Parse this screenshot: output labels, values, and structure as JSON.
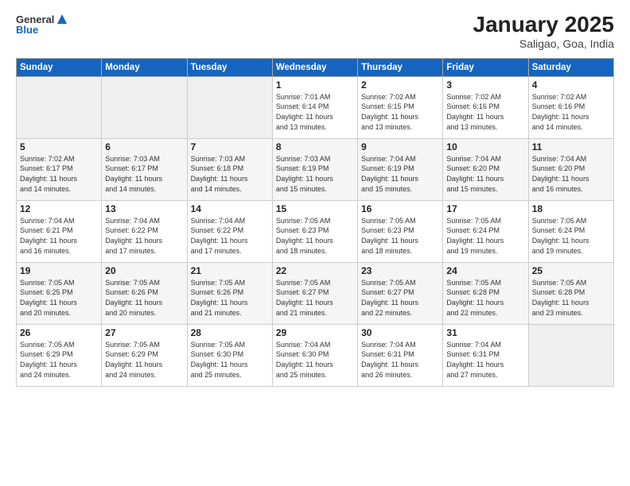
{
  "header": {
    "logo_line1": "General",
    "logo_line2": "Blue",
    "title": "January 2025",
    "subtitle": "Saligao, Goa, India"
  },
  "weekdays": [
    "Sunday",
    "Monday",
    "Tuesday",
    "Wednesday",
    "Thursday",
    "Friday",
    "Saturday"
  ],
  "weeks": [
    [
      {
        "day": "",
        "info": ""
      },
      {
        "day": "",
        "info": ""
      },
      {
        "day": "",
        "info": ""
      },
      {
        "day": "1",
        "info": "Sunrise: 7:01 AM\nSunset: 6:14 PM\nDaylight: 11 hours\nand 13 minutes."
      },
      {
        "day": "2",
        "info": "Sunrise: 7:02 AM\nSunset: 6:15 PM\nDaylight: 11 hours\nand 13 minutes."
      },
      {
        "day": "3",
        "info": "Sunrise: 7:02 AM\nSunset: 6:16 PM\nDaylight: 11 hours\nand 13 minutes."
      },
      {
        "day": "4",
        "info": "Sunrise: 7:02 AM\nSunset: 6:16 PM\nDaylight: 11 hours\nand 14 minutes."
      }
    ],
    [
      {
        "day": "5",
        "info": "Sunrise: 7:02 AM\nSunset: 6:17 PM\nDaylight: 11 hours\nand 14 minutes."
      },
      {
        "day": "6",
        "info": "Sunrise: 7:03 AM\nSunset: 6:17 PM\nDaylight: 11 hours\nand 14 minutes."
      },
      {
        "day": "7",
        "info": "Sunrise: 7:03 AM\nSunset: 6:18 PM\nDaylight: 11 hours\nand 14 minutes."
      },
      {
        "day": "8",
        "info": "Sunrise: 7:03 AM\nSunset: 6:19 PM\nDaylight: 11 hours\nand 15 minutes."
      },
      {
        "day": "9",
        "info": "Sunrise: 7:04 AM\nSunset: 6:19 PM\nDaylight: 11 hours\nand 15 minutes."
      },
      {
        "day": "10",
        "info": "Sunrise: 7:04 AM\nSunset: 6:20 PM\nDaylight: 11 hours\nand 15 minutes."
      },
      {
        "day": "11",
        "info": "Sunrise: 7:04 AM\nSunset: 6:20 PM\nDaylight: 11 hours\nand 16 minutes."
      }
    ],
    [
      {
        "day": "12",
        "info": "Sunrise: 7:04 AM\nSunset: 6:21 PM\nDaylight: 11 hours\nand 16 minutes."
      },
      {
        "day": "13",
        "info": "Sunrise: 7:04 AM\nSunset: 6:22 PM\nDaylight: 11 hours\nand 17 minutes."
      },
      {
        "day": "14",
        "info": "Sunrise: 7:04 AM\nSunset: 6:22 PM\nDaylight: 11 hours\nand 17 minutes."
      },
      {
        "day": "15",
        "info": "Sunrise: 7:05 AM\nSunset: 6:23 PM\nDaylight: 11 hours\nand 18 minutes."
      },
      {
        "day": "16",
        "info": "Sunrise: 7:05 AM\nSunset: 6:23 PM\nDaylight: 11 hours\nand 18 minutes."
      },
      {
        "day": "17",
        "info": "Sunrise: 7:05 AM\nSunset: 6:24 PM\nDaylight: 11 hours\nand 19 minutes."
      },
      {
        "day": "18",
        "info": "Sunrise: 7:05 AM\nSunset: 6:24 PM\nDaylight: 11 hours\nand 19 minutes."
      }
    ],
    [
      {
        "day": "19",
        "info": "Sunrise: 7:05 AM\nSunset: 6:25 PM\nDaylight: 11 hours\nand 20 minutes."
      },
      {
        "day": "20",
        "info": "Sunrise: 7:05 AM\nSunset: 6:26 PM\nDaylight: 11 hours\nand 20 minutes."
      },
      {
        "day": "21",
        "info": "Sunrise: 7:05 AM\nSunset: 6:26 PM\nDaylight: 11 hours\nand 21 minutes."
      },
      {
        "day": "22",
        "info": "Sunrise: 7:05 AM\nSunset: 6:27 PM\nDaylight: 11 hours\nand 21 minutes."
      },
      {
        "day": "23",
        "info": "Sunrise: 7:05 AM\nSunset: 6:27 PM\nDaylight: 11 hours\nand 22 minutes."
      },
      {
        "day": "24",
        "info": "Sunrise: 7:05 AM\nSunset: 6:28 PM\nDaylight: 11 hours\nand 22 minutes."
      },
      {
        "day": "25",
        "info": "Sunrise: 7:05 AM\nSunset: 6:28 PM\nDaylight: 11 hours\nand 23 minutes."
      }
    ],
    [
      {
        "day": "26",
        "info": "Sunrise: 7:05 AM\nSunset: 6:29 PM\nDaylight: 11 hours\nand 24 minutes."
      },
      {
        "day": "27",
        "info": "Sunrise: 7:05 AM\nSunset: 6:29 PM\nDaylight: 11 hours\nand 24 minutes."
      },
      {
        "day": "28",
        "info": "Sunrise: 7:05 AM\nSunset: 6:30 PM\nDaylight: 11 hours\nand 25 minutes."
      },
      {
        "day": "29",
        "info": "Sunrise: 7:04 AM\nSunset: 6:30 PM\nDaylight: 11 hours\nand 25 minutes."
      },
      {
        "day": "30",
        "info": "Sunrise: 7:04 AM\nSunset: 6:31 PM\nDaylight: 11 hours\nand 26 minutes."
      },
      {
        "day": "31",
        "info": "Sunrise: 7:04 AM\nSunset: 6:31 PM\nDaylight: 11 hours\nand 27 minutes."
      },
      {
        "day": "",
        "info": ""
      }
    ]
  ]
}
